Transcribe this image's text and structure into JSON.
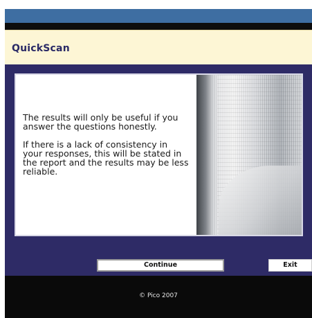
{
  "header": {
    "app_title": "QuickScan"
  },
  "main": {
    "message_paragraphs": [
      "The results will only be useful if you answer the questions honestly.",
      "If there is a lack of consistency in your responses, this will be stated in the report and the results may be less reliable."
    ],
    "image_icon": "open-book-photo"
  },
  "buttons": {
    "continue_label": "Continue",
    "exit_label": "Exit"
  },
  "footer": {
    "copyright": "© Pico 2007"
  },
  "colors": {
    "title_bar": "#3e6ea2",
    "header_bg": "#fdf6d5",
    "title_text": "#2a2a66",
    "panel_bg": "#2e2b66",
    "footer_bg": "#0a0a0a"
  }
}
